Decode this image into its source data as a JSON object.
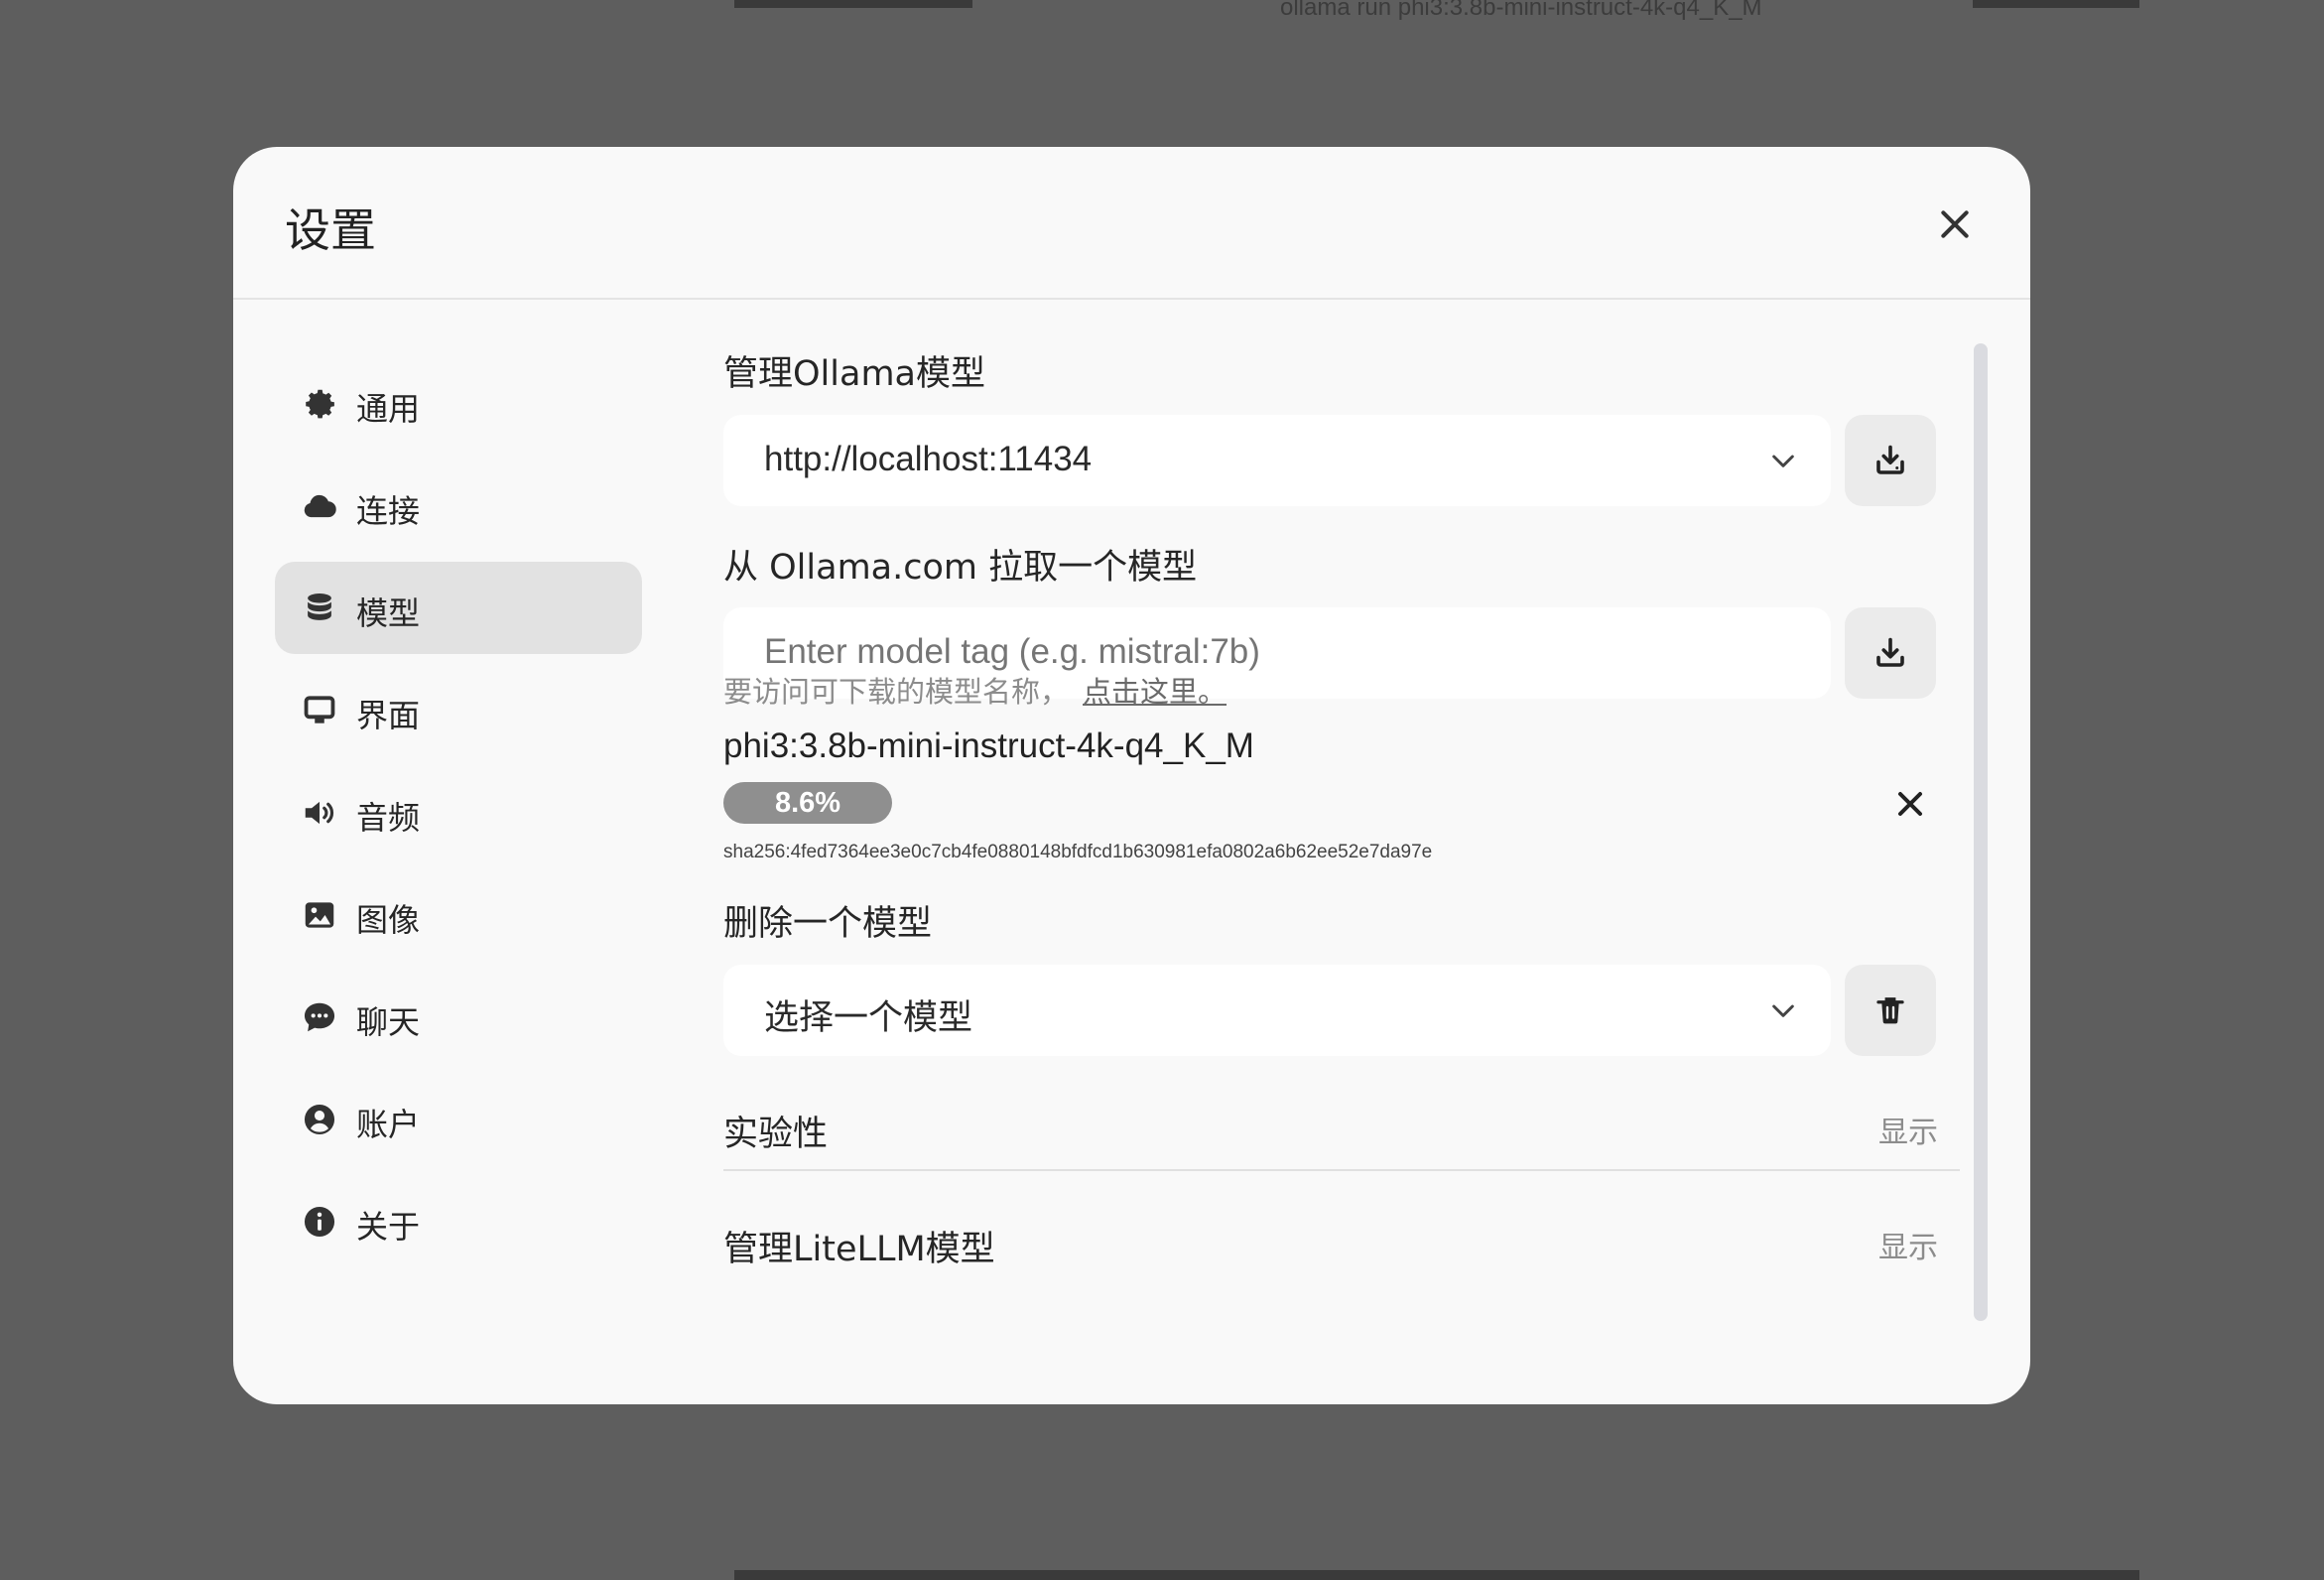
{
  "background": {
    "peek_text": "ollama run phi3:3.8b-mini-instruct-4k-q4_K_M"
  },
  "modal": {
    "title": "设置"
  },
  "sidebar": {
    "items": [
      {
        "label": "通用",
        "icon": "gear-icon"
      },
      {
        "label": "连接",
        "icon": "cloud-icon"
      },
      {
        "label": "模型",
        "icon": "database-icon",
        "active": true
      },
      {
        "label": "界面",
        "icon": "monitor-icon"
      },
      {
        "label": "音频",
        "icon": "speaker-icon"
      },
      {
        "label": "图像",
        "icon": "image-icon"
      },
      {
        "label": "聊天",
        "icon": "chat-bubble-icon"
      },
      {
        "label": "账户",
        "icon": "user-circle-icon"
      },
      {
        "label": "关于",
        "icon": "info-icon"
      }
    ]
  },
  "models": {
    "manage_ollama_title": "管理Ollama模型",
    "ollama_url": "http://localhost:11434",
    "pull_title": "从 Ollama.com 拉取一个模型",
    "pull_placeholder": "Enter model tag (e.g. mistral:7b)",
    "hint_text": "要访问可下载的模型名称，",
    "hint_link": "点击这里。",
    "download": {
      "model_name": "phi3:3.8b-mini-instruct-4k-q4_K_M",
      "progress_label": "8.6%",
      "progress": 0.086,
      "digest": "sha256:4fed7364ee3e0c7cb4fe0880148bfdfcd1b630981efa0802a6b62ee52e7da97e"
    },
    "delete_title": "删除一个模型",
    "delete_select_value": "选择一个模型",
    "experimental_title": "实验性",
    "experimental_toggle": "显示",
    "litellm_title": "管理LiteLLM模型",
    "litellm_toggle": "显示"
  },
  "colors": {
    "overlay": "#5e5e5e",
    "modal_bg": "#f9f9f9",
    "active_nav": "#e2e2e2",
    "progress_bg": "#8f8f8f"
  }
}
